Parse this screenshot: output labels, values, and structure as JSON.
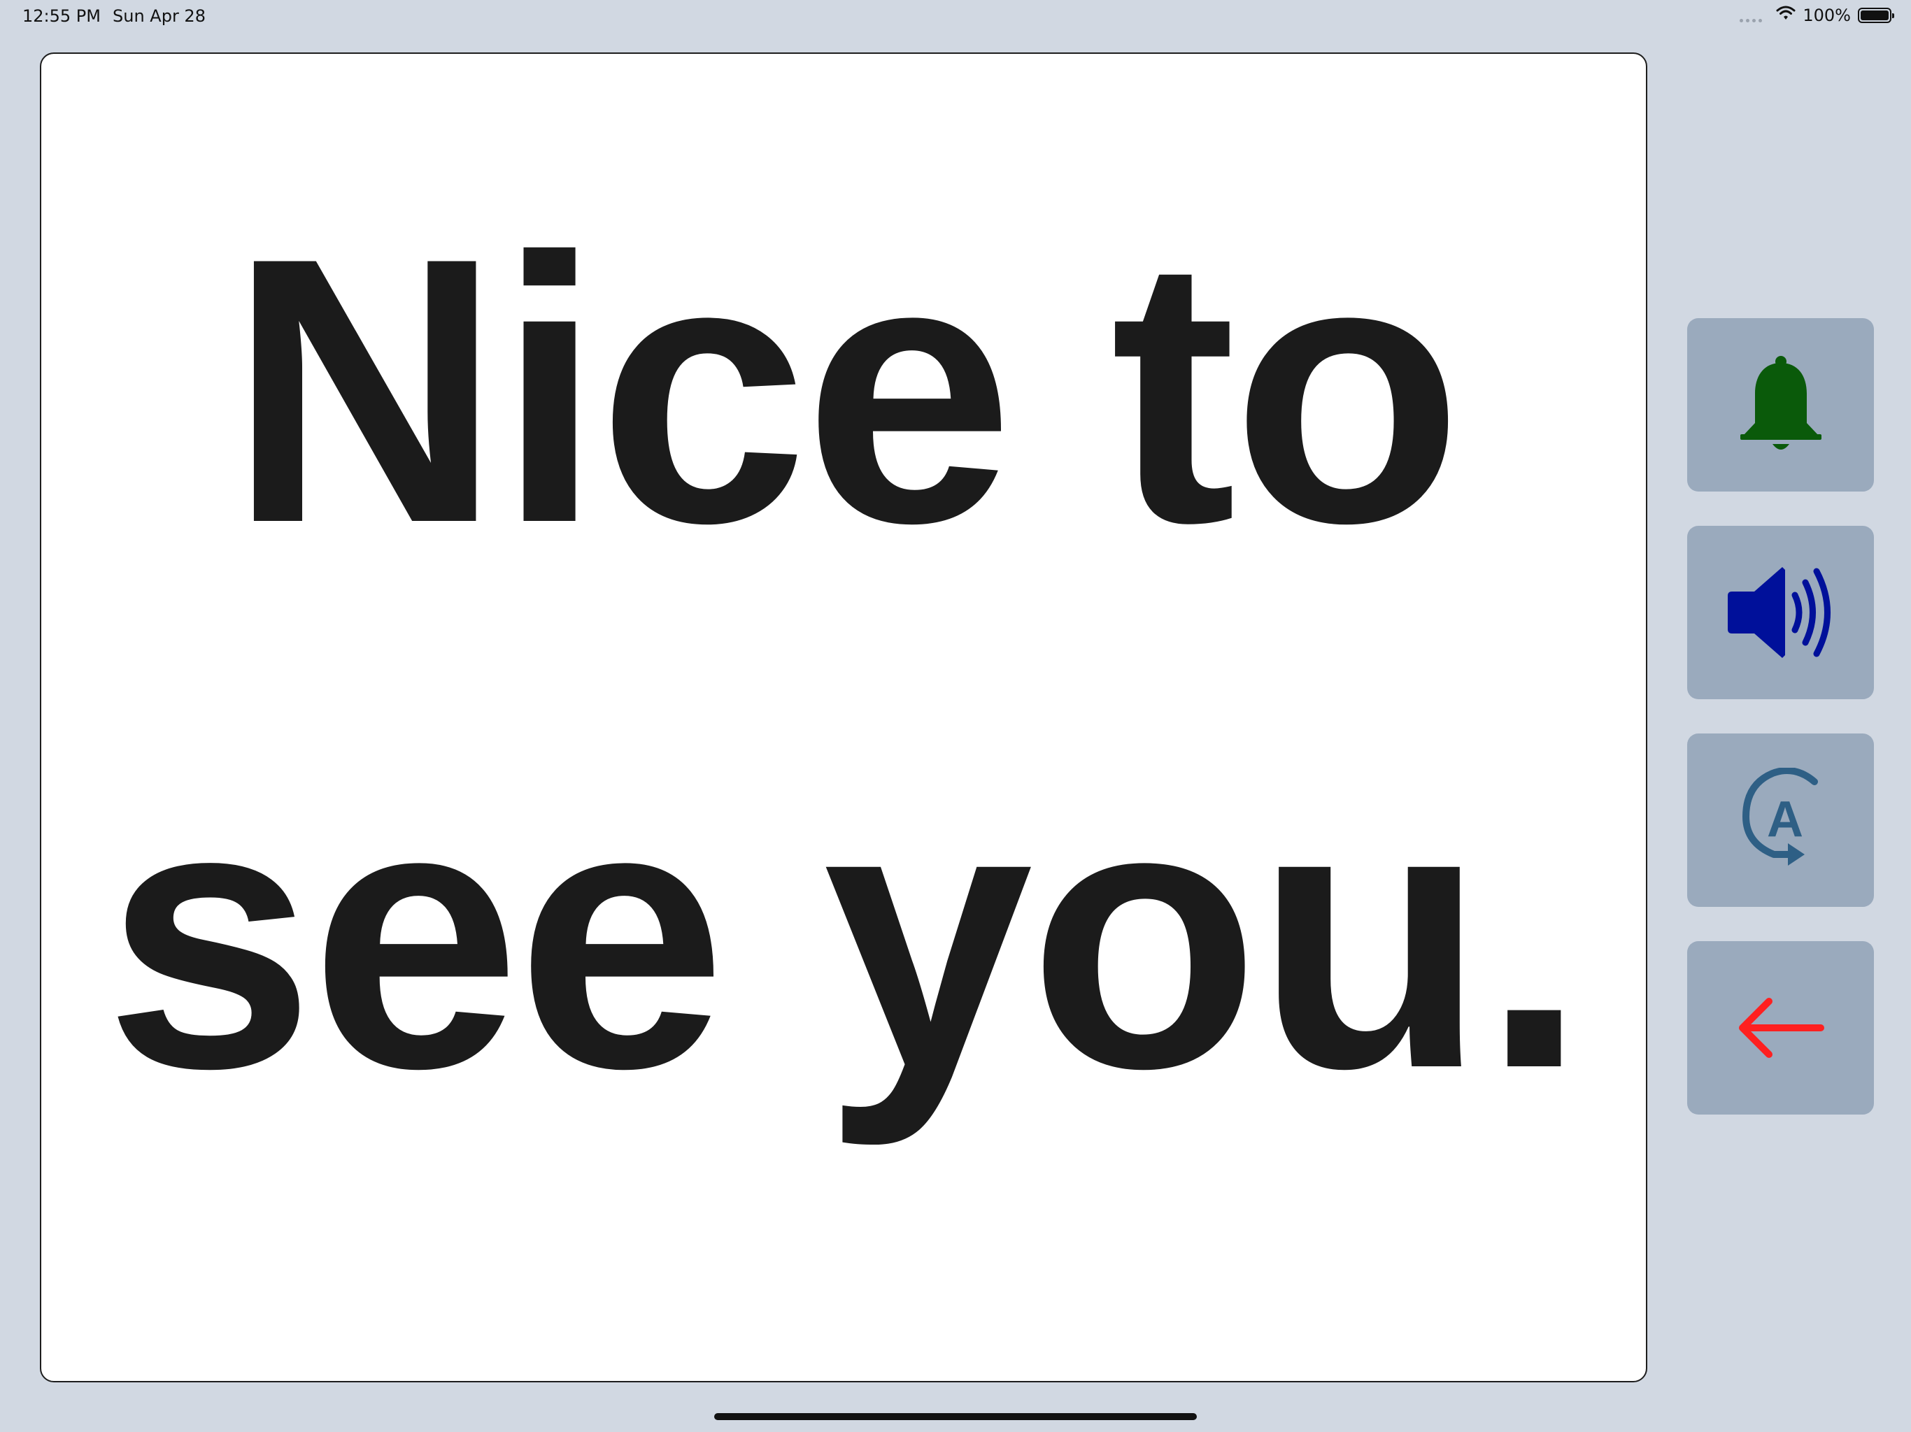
{
  "status_bar": {
    "time": "12:55 PM",
    "date": "Sun Apr 28",
    "battery": "100%"
  },
  "message": {
    "text": "Nice to see you."
  },
  "side_buttons": [
    {
      "name": "alert-button",
      "icon": "bell-icon",
      "color": "#0a5a0a"
    },
    {
      "name": "speak-button",
      "icon": "speaker-wave-icon",
      "color": "#00109a"
    },
    {
      "name": "rephrase-button",
      "icon": "rotate-text-icon",
      "color": "#2e5f85"
    },
    {
      "name": "back-button",
      "icon": "arrow-left-icon",
      "color": "#ff2020"
    }
  ],
  "colors": {
    "background": "#d1d8e2",
    "card": "#ffffff",
    "button": "#9aaabd",
    "text": "#1b1b1b"
  }
}
